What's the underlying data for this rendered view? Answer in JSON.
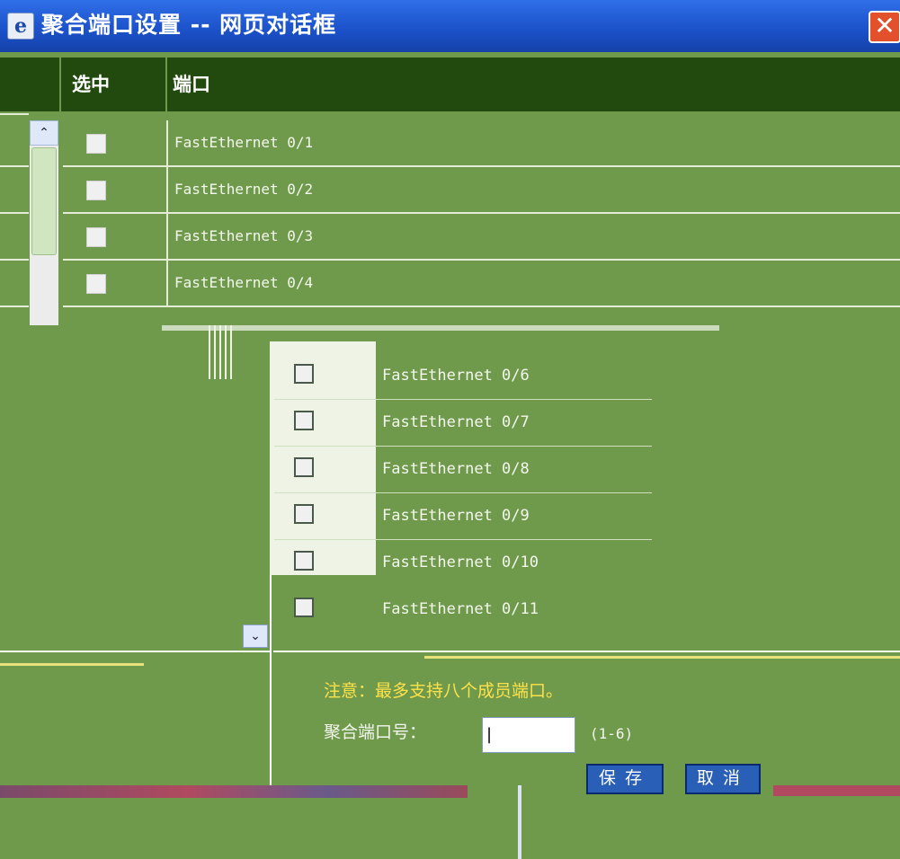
{
  "window": {
    "title": "聚合端口设置 -- 网页对话框",
    "close_glyph": "✕",
    "icon": "ie-icon"
  },
  "table": {
    "headers": {
      "select": "选中",
      "port": "端口"
    },
    "rows": [
      "FastEthernet 0/1",
      "FastEthernet 0/2",
      "FastEthernet 0/3",
      "FastEthernet 0/4"
    ],
    "floating_rows": [
      "FastEthernet 0/6",
      "FastEthernet 0/7",
      "FastEthernet 0/8",
      "FastEthernet 0/9",
      "FastEthernet 0/10",
      "FastEthernet 0/11"
    ]
  },
  "scrollbar": {
    "up_glyph": "⌃",
    "down_glyph": "⌄"
  },
  "form": {
    "notice": "注意：最多支持八个成员端口。",
    "port_label": "聚合端口号：",
    "port_value": "|",
    "range_hint": "(1-6)",
    "save_label": "保存",
    "cancel_label": "取消"
  },
  "colors": {
    "background": "#6f9a4c",
    "header": "#234a0e",
    "titlebar": "#1b50c8",
    "notice": "#ffe24a",
    "button": "#2a5fb8"
  }
}
